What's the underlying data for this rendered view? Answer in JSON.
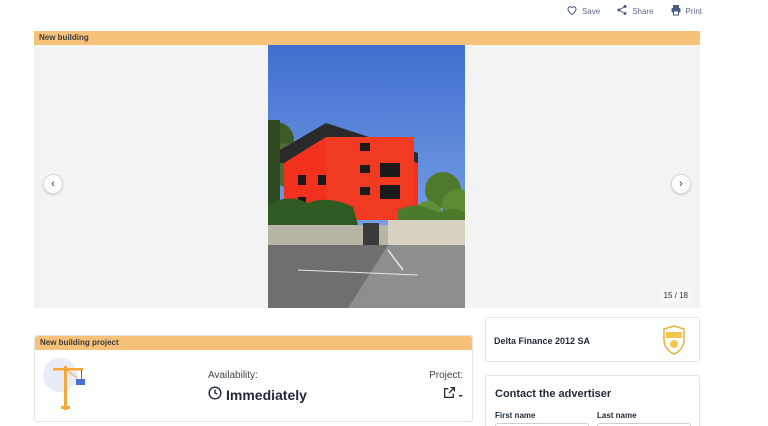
{
  "actions": {
    "save": "Save",
    "share": "Share",
    "print": "Print"
  },
  "gallery": {
    "badge": "New building",
    "counter": "15 / 18"
  },
  "project": {
    "header": "New building project",
    "availability_label": "Availability:",
    "availability_value": "Immediately",
    "project_label": "Project:",
    "project_value": "-"
  },
  "agency": {
    "name": "Delta Finance 2012 SA"
  },
  "contact": {
    "title": "Contact the advertiser",
    "first_name_label": "First name",
    "last_name_label": "Last name"
  },
  "colors": {
    "accent_bar": "#f6c27a",
    "icon_blue": "#5b6b8c"
  }
}
